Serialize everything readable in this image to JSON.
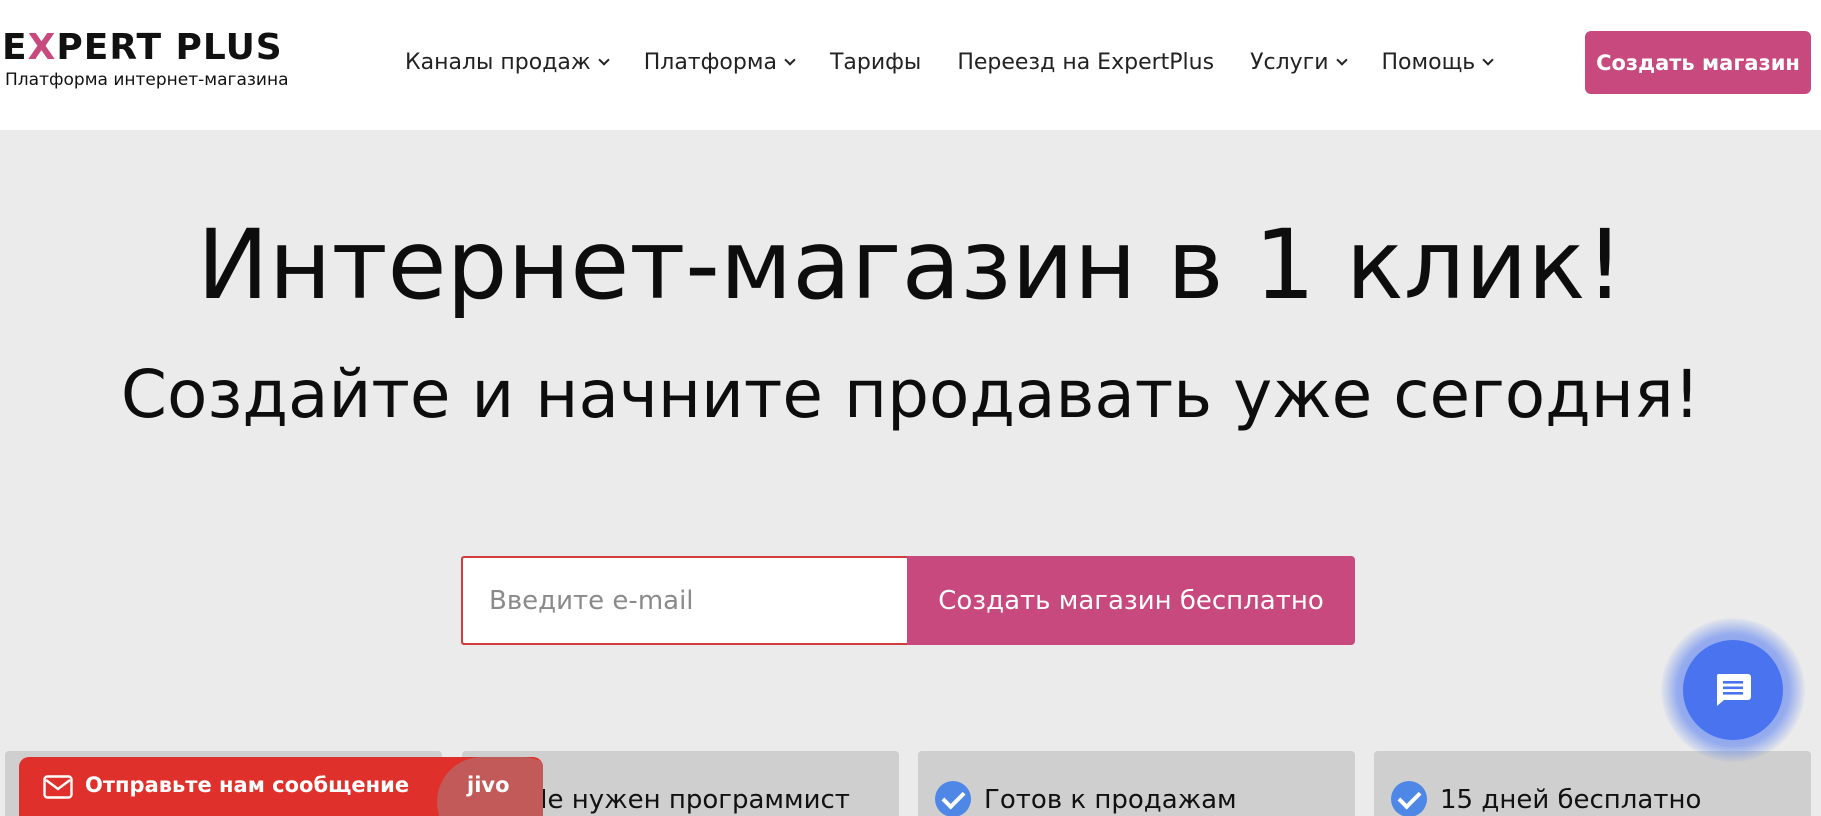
{
  "header": {
    "logo": {
      "wordmark_part1": "E",
      "wordmark_x": "X",
      "wordmark_part2": "PERT PLUS",
      "tagline": "Платформа интернет-магазина"
    },
    "nav": [
      {
        "label": "Каналы продаж",
        "has_dropdown": true
      },
      {
        "label": "Платформа",
        "has_dropdown": true
      },
      {
        "label": "Тарифы",
        "has_dropdown": false
      },
      {
        "label": "Переезд на ExpertPlus",
        "has_dropdown": false
      },
      {
        "label": "Услуги",
        "has_dropdown": true
      },
      {
        "label": "Помощь",
        "has_dropdown": true
      }
    ],
    "cta_label": "Создать магазин"
  },
  "hero": {
    "title": "Интернет-магазин в 1 клик!",
    "subtitle": "Создайте и начните продавать уже сегодня!",
    "email_placeholder": "Введите e-mail",
    "email_value": "",
    "signup_label": "Создать магазин бесплатно"
  },
  "features": [
    {
      "label": "",
      "checked": false
    },
    {
      "label": "Не нужен программист",
      "checked": true
    },
    {
      "label": "Готов к продажам",
      "checked": true
    },
    {
      "label": "15 дней бесплатно",
      "checked": true
    }
  ],
  "jivo": {
    "message_label": "Отправьте нам сообщение",
    "brand": "jivo",
    "icon": "envelope-icon"
  },
  "chat_widget": {
    "icon": "chat-bubble-icon"
  },
  "colors": {
    "accent": "#c8497e",
    "hero_bg": "#ebebeb",
    "card_bg": "#cfcfcf",
    "check_blue": "#4f87e6",
    "jivo_red": "#e0302b",
    "chat_blue": "#4a74ef"
  }
}
